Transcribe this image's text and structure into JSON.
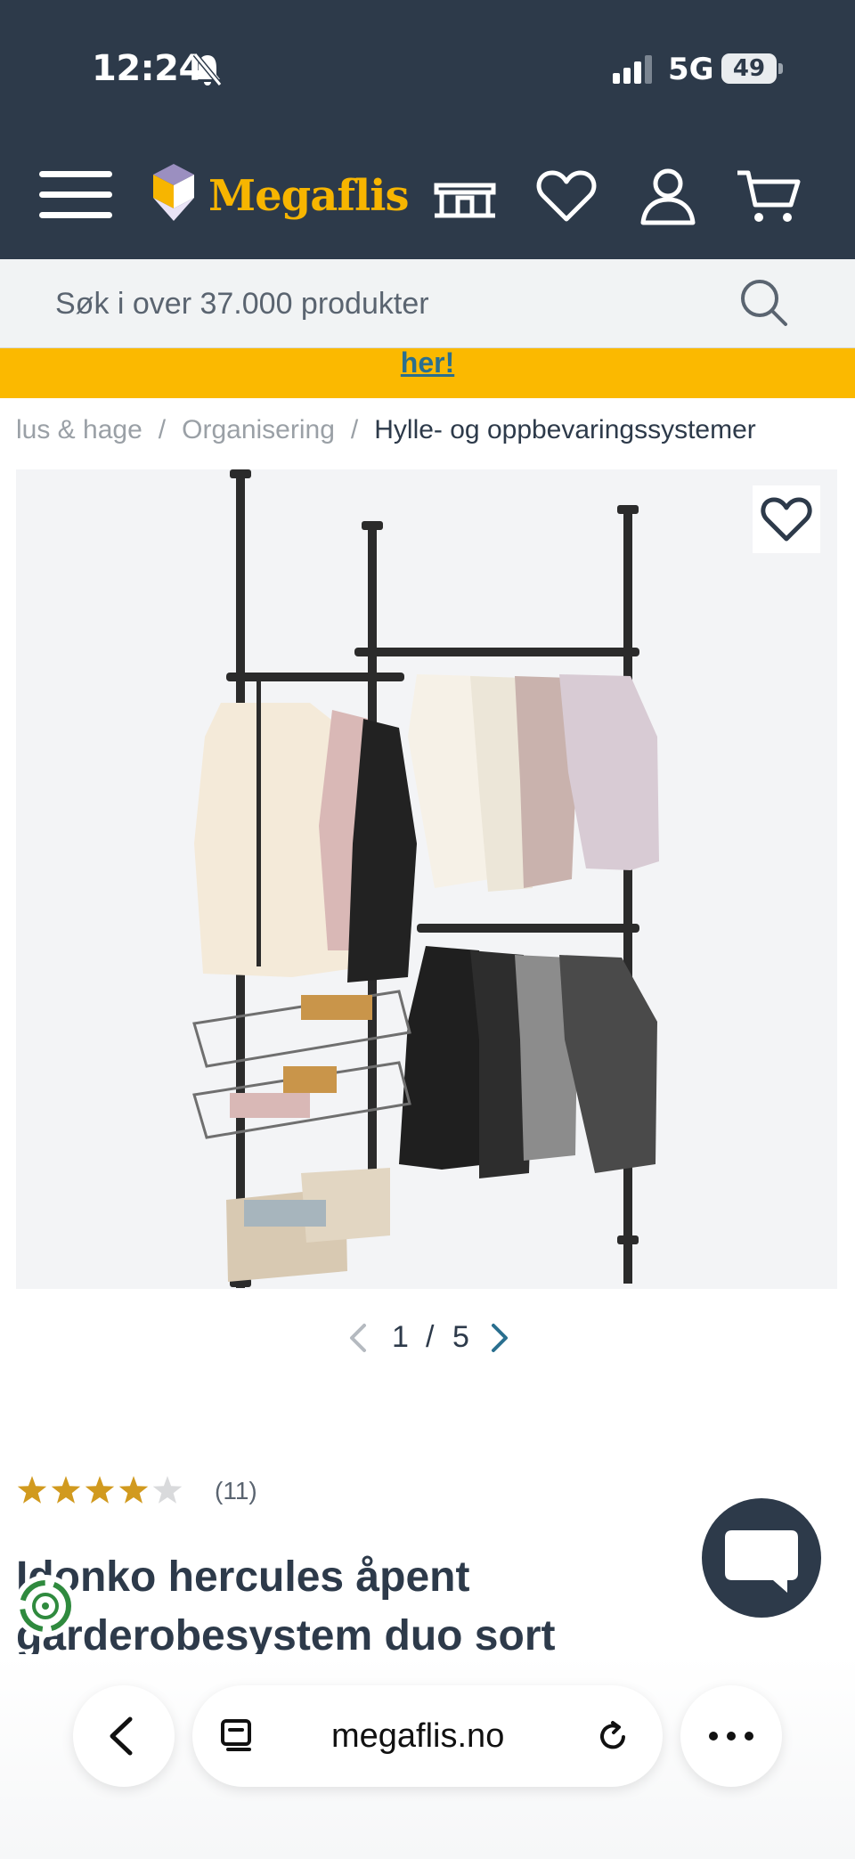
{
  "status_bar": {
    "time": "12:24",
    "network": "5G",
    "battery": "49"
  },
  "header": {
    "brand": "Megaflis"
  },
  "search": {
    "placeholder": "Søk i over 37.000 produkter"
  },
  "promo": {
    "link_text": "her!"
  },
  "breadcrumb": [
    {
      "label": "lus & hage"
    },
    {
      "label": "Organisering"
    },
    {
      "label": "Hylle- og oppbevaringssystemer"
    }
  ],
  "gallery": {
    "current": "1",
    "separator": "/",
    "total": "5"
  },
  "product": {
    "rating": 4,
    "rating_max": 5,
    "review_count": "(11)",
    "title_line1": "Idonko hercules åpent",
    "title_line2": "garderobesystem duo sort"
  },
  "browser": {
    "url": "megaflis.no"
  },
  "colors": {
    "header_bg": "#2d3a4a",
    "brand_yellow": "#f7b500",
    "promo_bg": "#fbb900",
    "star": "#d19a1f",
    "link": "#2a6f8f"
  }
}
